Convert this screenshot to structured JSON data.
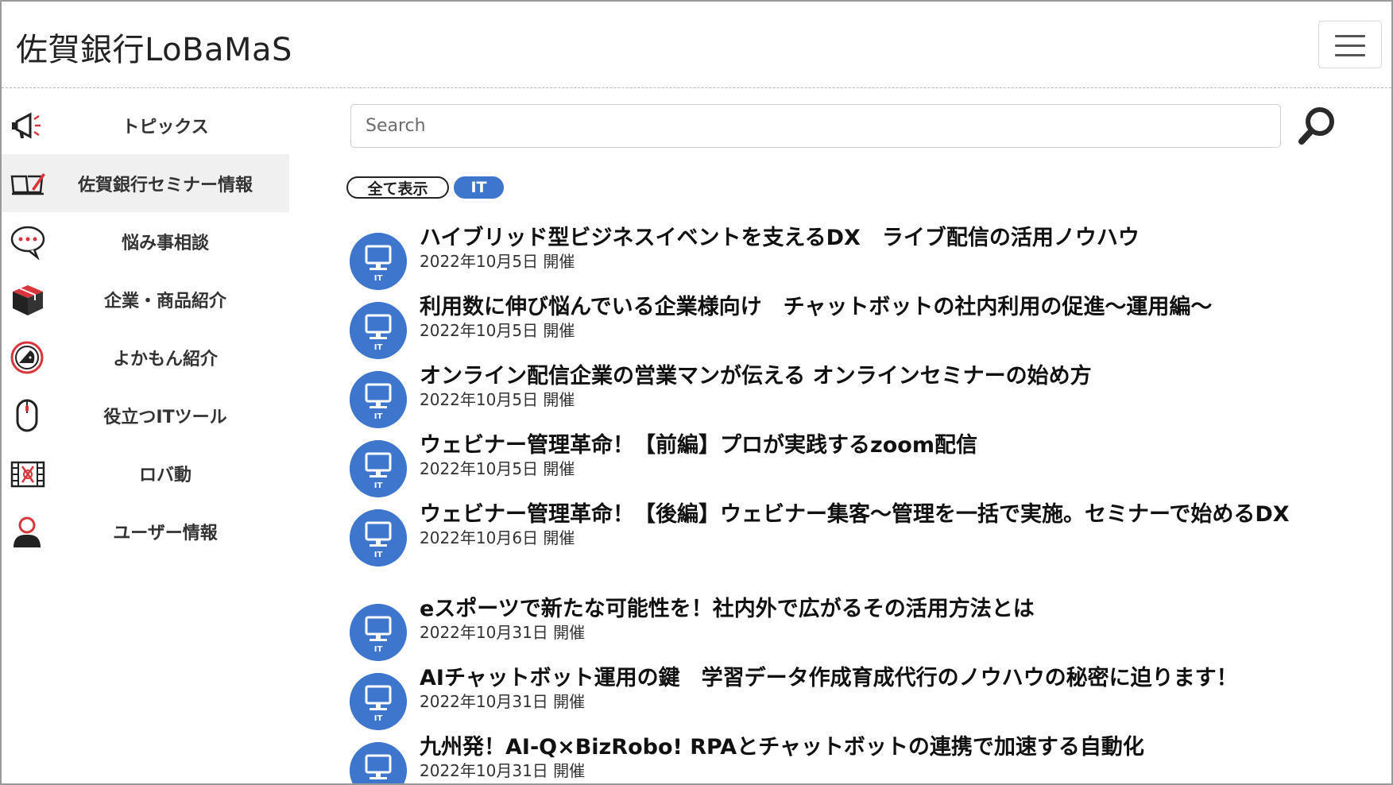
{
  "header": {
    "title": "佐賀銀行LoBaMaS",
    "menu_icon": "hamburger-icon"
  },
  "sidebar": {
    "items": [
      {
        "label": "トピックス",
        "icon": "megaphone-icon",
        "active": false
      },
      {
        "label": "佐賀銀行セミナー情報",
        "icon": "open-book-icon",
        "active": true
      },
      {
        "label": "悩み事相談",
        "icon": "speech-bubble-icon",
        "active": false
      },
      {
        "label": "企業・商品紹介",
        "icon": "package-icon",
        "active": false
      },
      {
        "label": "よかもん紹介",
        "icon": "badge-icon",
        "active": false
      },
      {
        "label": "役立つITツール",
        "icon": "mouse-icon",
        "active": false
      },
      {
        "label": "ロバ動",
        "icon": "film-icon",
        "active": false
      },
      {
        "label": "ユーザー情報",
        "icon": "user-icon",
        "active": false
      }
    ]
  },
  "search": {
    "placeholder": "Search",
    "value": ""
  },
  "filters": {
    "show_all": "全て表示",
    "it": "IT"
  },
  "event_icon_label": "IT",
  "colors": {
    "accent": "#3e76cd",
    "sidebar_active_bg": "#f0f0f0"
  },
  "events": [
    {
      "title": "ハイブリッド型ビジネスイベントを支えるDX　ライブ配信の活用ノウハウ",
      "date": "2022年10月5日 開催"
    },
    {
      "title": "利用数に伸び悩んでいる企業様向け　チャットボットの社内利用の促進～運用編～",
      "date": "2022年10月5日 開催"
    },
    {
      "title": "オンライン配信企業の営業マンが伝える オンラインセミナーの始め方",
      "date": "2022年10月5日 開催"
    },
    {
      "title": "ウェビナー管理革命！【前編】プロが実践するzoom配信",
      "date": "2022年10月5日 開催"
    },
    {
      "title": "ウェビナー管理革命！【後編】ウェビナー集客～管理を一括で実施。セミナーで始めるDX",
      "date": "2022年10月6日 開催"
    },
    {
      "title": "eスポーツで新たな可能性を！社内外で広がるその活用方法とは",
      "date": "2022年10月31日 開催"
    },
    {
      "title": "AIチャットボット運用の鍵　学習データ作成育成代行のノウハウの秘密に迫ります！",
      "date": "2022年10月31日 開催"
    },
    {
      "title": "九州発！AI-Q×BizRobo! RPAとチャットボットの連携で加速する自動化",
      "date": "2022年10月31日 開催"
    }
  ]
}
